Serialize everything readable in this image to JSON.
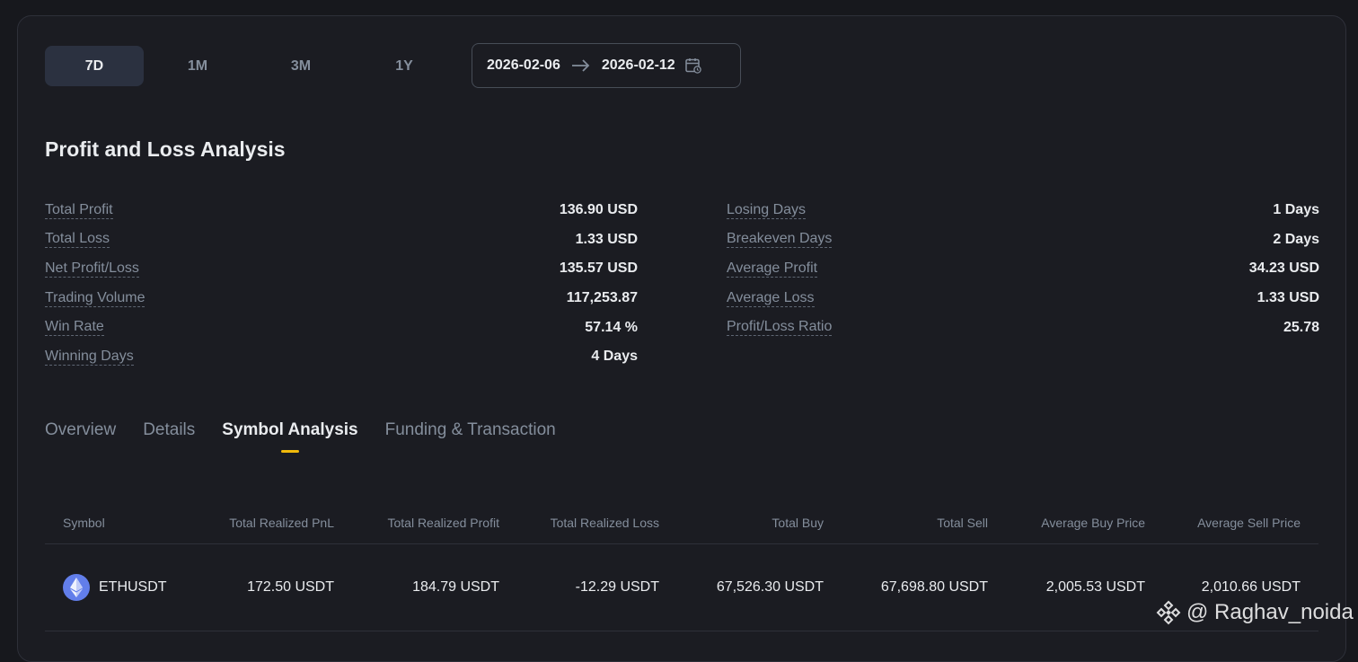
{
  "periods": {
    "items": [
      "7D",
      "1M",
      "3M",
      "1Y"
    ],
    "active": "7D"
  },
  "date_range": {
    "start": "2026-02-06",
    "end": "2026-02-12"
  },
  "analysis": {
    "title": "Profit and Loss Analysis",
    "left": [
      {
        "label": "Total Profit",
        "value": "136.90 USD"
      },
      {
        "label": "Total Loss",
        "value": "1.33 USD"
      },
      {
        "label": "Net Profit/Loss",
        "value": "135.57 USD"
      },
      {
        "label": "Trading Volume",
        "value": "117,253.87"
      },
      {
        "label": "Win Rate",
        "value": "57.14 %"
      },
      {
        "label": "Winning Days",
        "value": "4 Days"
      }
    ],
    "right": [
      {
        "label": "Losing Days",
        "value": "1 Days"
      },
      {
        "label": "Breakeven Days",
        "value": "2 Days"
      },
      {
        "label": "Average Profit",
        "value": "34.23 USD"
      },
      {
        "label": "Average Loss",
        "value": "1.33 USD"
      },
      {
        "label": "Profit/Loss Ratio",
        "value": "25.78"
      }
    ]
  },
  "tabs": {
    "items": [
      "Overview",
      "Details",
      "Symbol Analysis",
      "Funding & Transaction"
    ],
    "active": "Symbol Analysis"
  },
  "table": {
    "headers": [
      "Symbol",
      "Total Realized PnL",
      "Total Realized Profit",
      "Total Realized Loss",
      "Total Buy",
      "Total Sell",
      "Average Buy Price",
      "Average Sell Price"
    ],
    "rows": [
      {
        "symbol": "ETHUSDT",
        "icon": "ethereum-icon",
        "cells": [
          "172.50 USDT",
          "184.79 USDT",
          "-12.29 USDT",
          "67,526.30 USDT",
          "67,698.80 USDT",
          "2,005.53 USDT",
          "2,010.66 USDT"
        ]
      }
    ]
  },
  "watermark": {
    "text": "@ Raghav_noida",
    "icon": "binance-logo-icon"
  },
  "colors": {
    "accent": "#f0b90b",
    "eth": "#627eea",
    "panel": "#1b1c22",
    "muted": "#848e9c"
  }
}
